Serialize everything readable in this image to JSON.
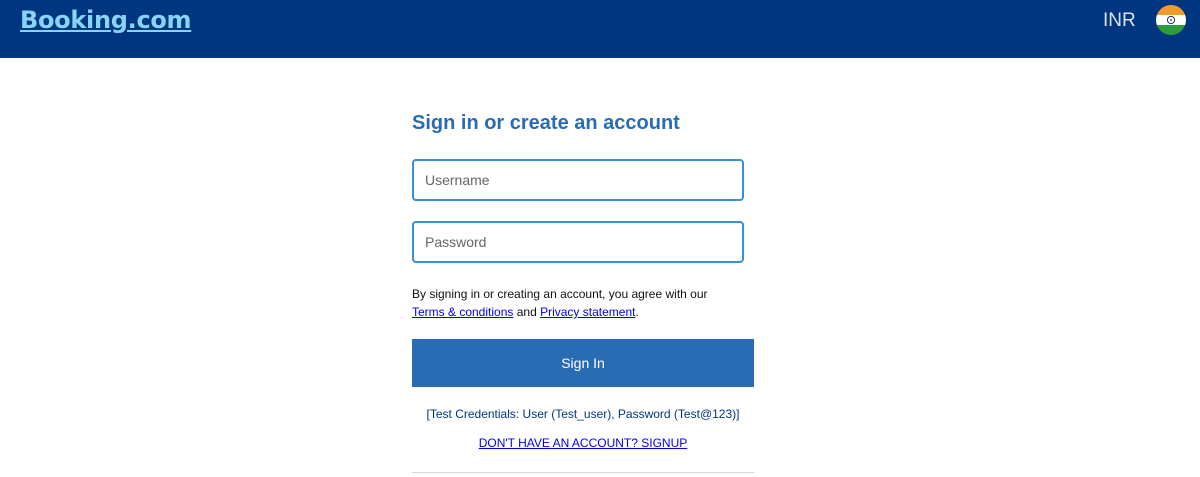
{
  "header": {
    "logo": "Booking.com",
    "currency": "INR",
    "flag_icon": "india-flag-icon"
  },
  "form": {
    "title": "Sign in or create an account",
    "username_placeholder": "Username",
    "password_placeholder": "Password",
    "terms_prefix": "By signing in or creating an account, you agree with our",
    "terms_link": "Terms & conditions",
    "terms_and": "and",
    "privacy_link": "Privacy statement",
    "terms_suffix": ".",
    "signin_label": "Sign In",
    "test_credentials": "[Test Credentials: User (Test_user), Password (Test@123)]",
    "signup_link": "DON'T HAVE AN ACCOUNT? SIGNUP"
  },
  "colors": {
    "header_bg": "#003580",
    "logo": "#86d4f7",
    "primary": "#2a6cb3",
    "input_border": "#3b8fd6"
  }
}
